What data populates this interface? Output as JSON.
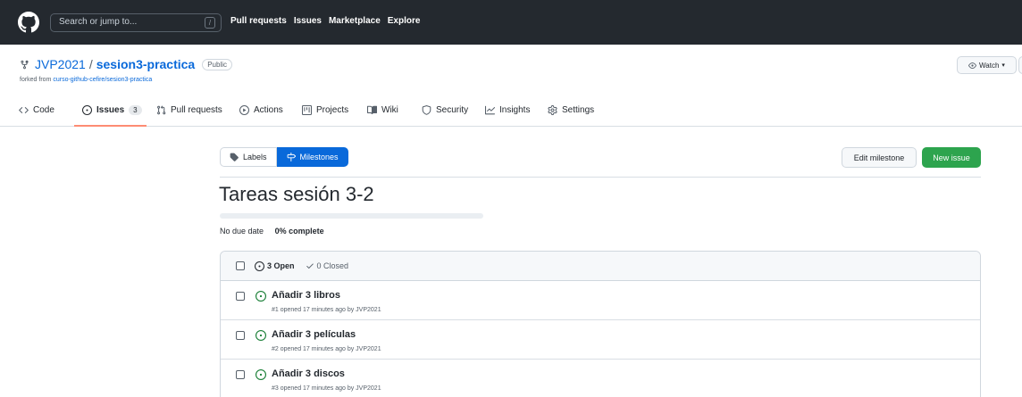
{
  "header": {
    "search_placeholder": "Search or jump to...",
    "search_shortcut": "/",
    "nav": [
      "Pull requests",
      "Issues",
      "Marketplace",
      "Explore"
    ]
  },
  "repo": {
    "owner": "JVP2021",
    "separator": "/",
    "name": "sesion3-practica",
    "visibility": "Public",
    "forked_prefix": "forked from",
    "forked_from": "curso-github-cefire/sesion3-practica",
    "watch_label": "Watch"
  },
  "tabs": {
    "code": "Code",
    "issues": "Issues",
    "issues_count": "3",
    "pull_requests": "Pull requests",
    "actions": "Actions",
    "projects": "Projects",
    "wiki": "Wiki",
    "security": "Security",
    "insights": "Insights",
    "settings": "Settings"
  },
  "subnav": {
    "labels": "Labels",
    "milestones": "Milestones"
  },
  "buttons": {
    "edit_milestone": "Edit milestone",
    "new_issue": "New issue"
  },
  "milestone": {
    "title": "Tareas sesión 3-2",
    "due": "No due date",
    "complete": "0% complete",
    "progress": 0
  },
  "issues_box": {
    "open": "3 Open",
    "closed": "0 Closed",
    "items": [
      {
        "title": "Añadir 3 libros",
        "meta": "#1 opened 17 minutes ago by JVP2021"
      },
      {
        "title": "Añadir 3 películas",
        "meta": "#2 opened 17 minutes ago by JVP2021"
      },
      {
        "title": "Añadir 3 discos",
        "meta": "#3 opened 17 minutes ago by JVP2021"
      }
    ]
  },
  "colors": {
    "header_bg": "#24292f",
    "link": "#0969da",
    "primary_green": "#2da44e",
    "tab_underline": "#fd8c73"
  },
  "icons": [
    "github-logo-icon",
    "repo-forked-icon",
    "eye-icon",
    "code-icon",
    "issue-opened-icon",
    "git-pull-request-icon",
    "play-icon",
    "project-icon",
    "book-icon",
    "shield-icon",
    "graph-icon",
    "gear-icon",
    "tag-icon",
    "milestone-icon",
    "check-icon"
  ]
}
